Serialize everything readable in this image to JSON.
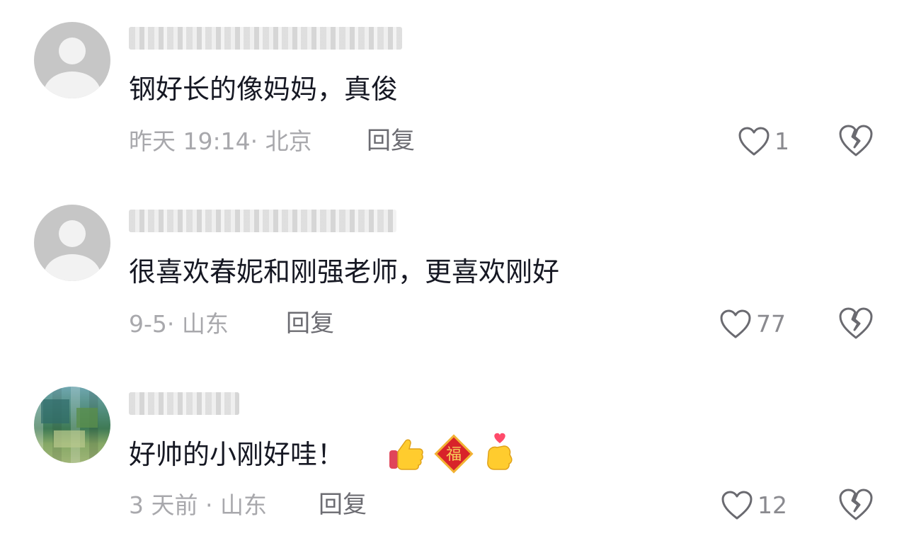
{
  "comments": [
    {
      "text": "钢好长的像妈妈，真俊",
      "meta": "昨天 19:14· 北京",
      "reply": "回复",
      "likes": "1",
      "avatar": "default-avatar"
    },
    {
      "text": "很喜欢春妮和刚强老师，更喜欢刚好",
      "meta": "9-5· 山东",
      "reply": "回复",
      "likes": "77",
      "avatar": "default-avatar"
    },
    {
      "text": "好帅的小刚好哇！",
      "meta": "3 天前 · 山东",
      "reply": "回复",
      "likes": "12",
      "avatar": "landscape-avatar",
      "emojis": [
        "thumbs-up-icon",
        "fu-blessing-icon",
        "finger-heart-icon"
      ],
      "fu_char": "福"
    }
  ],
  "icons": {
    "like": "heart-outline-icon",
    "dislike": "broken-heart-icon"
  },
  "colors": {
    "text": "#161823",
    "meta": "#a8a8ac",
    "reply": "#6c6c72",
    "icon": "#6a6a70"
  }
}
